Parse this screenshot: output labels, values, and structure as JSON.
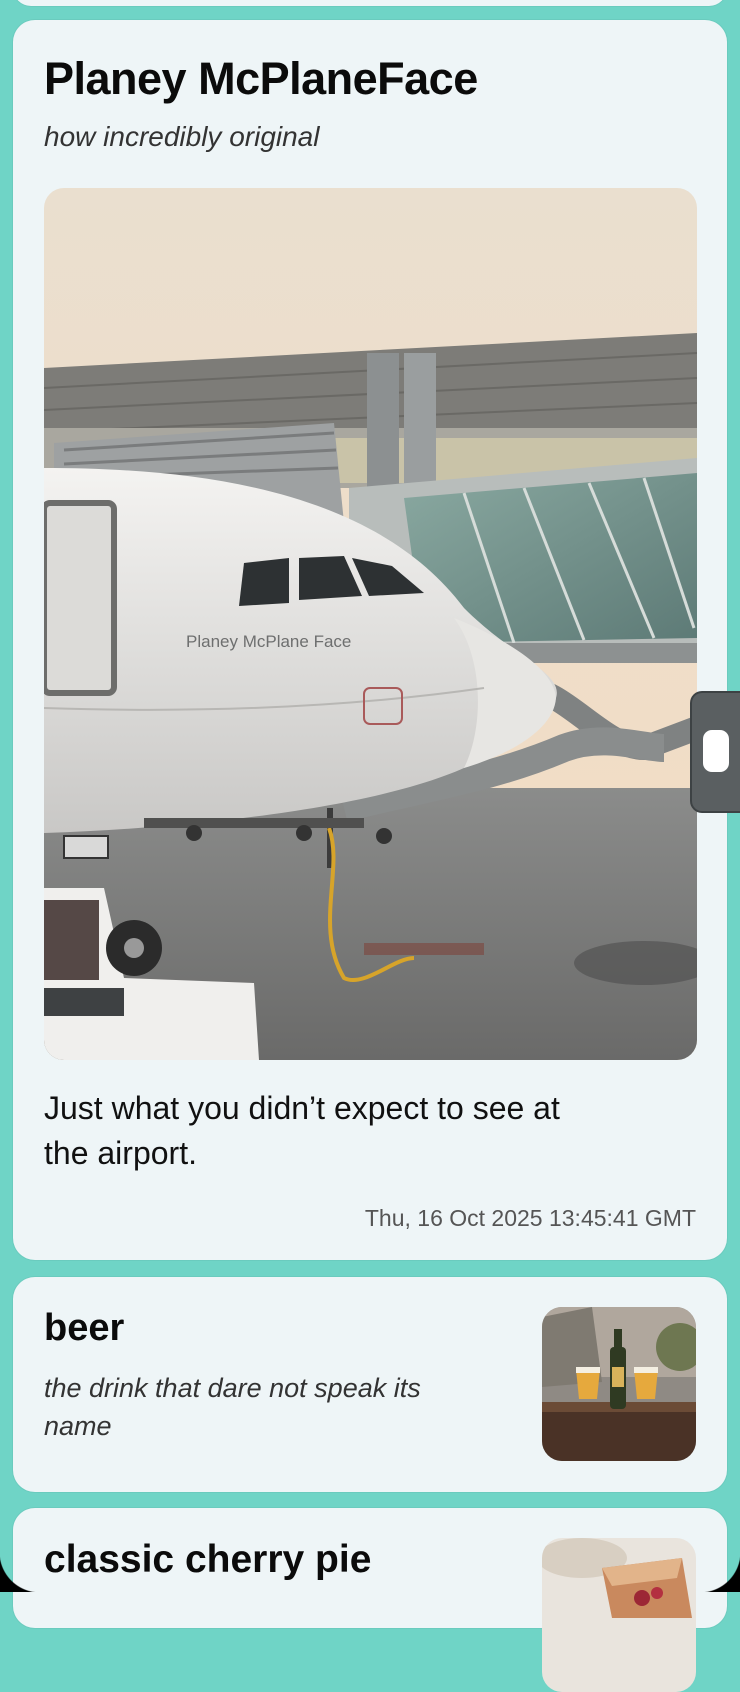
{
  "main_post": {
    "title": "Planey McPlaneFace",
    "subtitle": "how incredibly original",
    "photo_text": "Planey McPlane Face",
    "description": "Just what you didn’t expect to see at the airport.",
    "timestamp": "Thu, 16 Oct 2025 13:45:41 GMT"
  },
  "beer_post": {
    "title": "beer",
    "subtitle": "the drink that dare not speak its name"
  },
  "pie_post": {
    "title": "classic cherry pie"
  },
  "icons": {
    "scroll_handle": "scroll-handle-icon"
  },
  "colors": {
    "background": "#6fd4c6",
    "card": "#eef5f7"
  }
}
